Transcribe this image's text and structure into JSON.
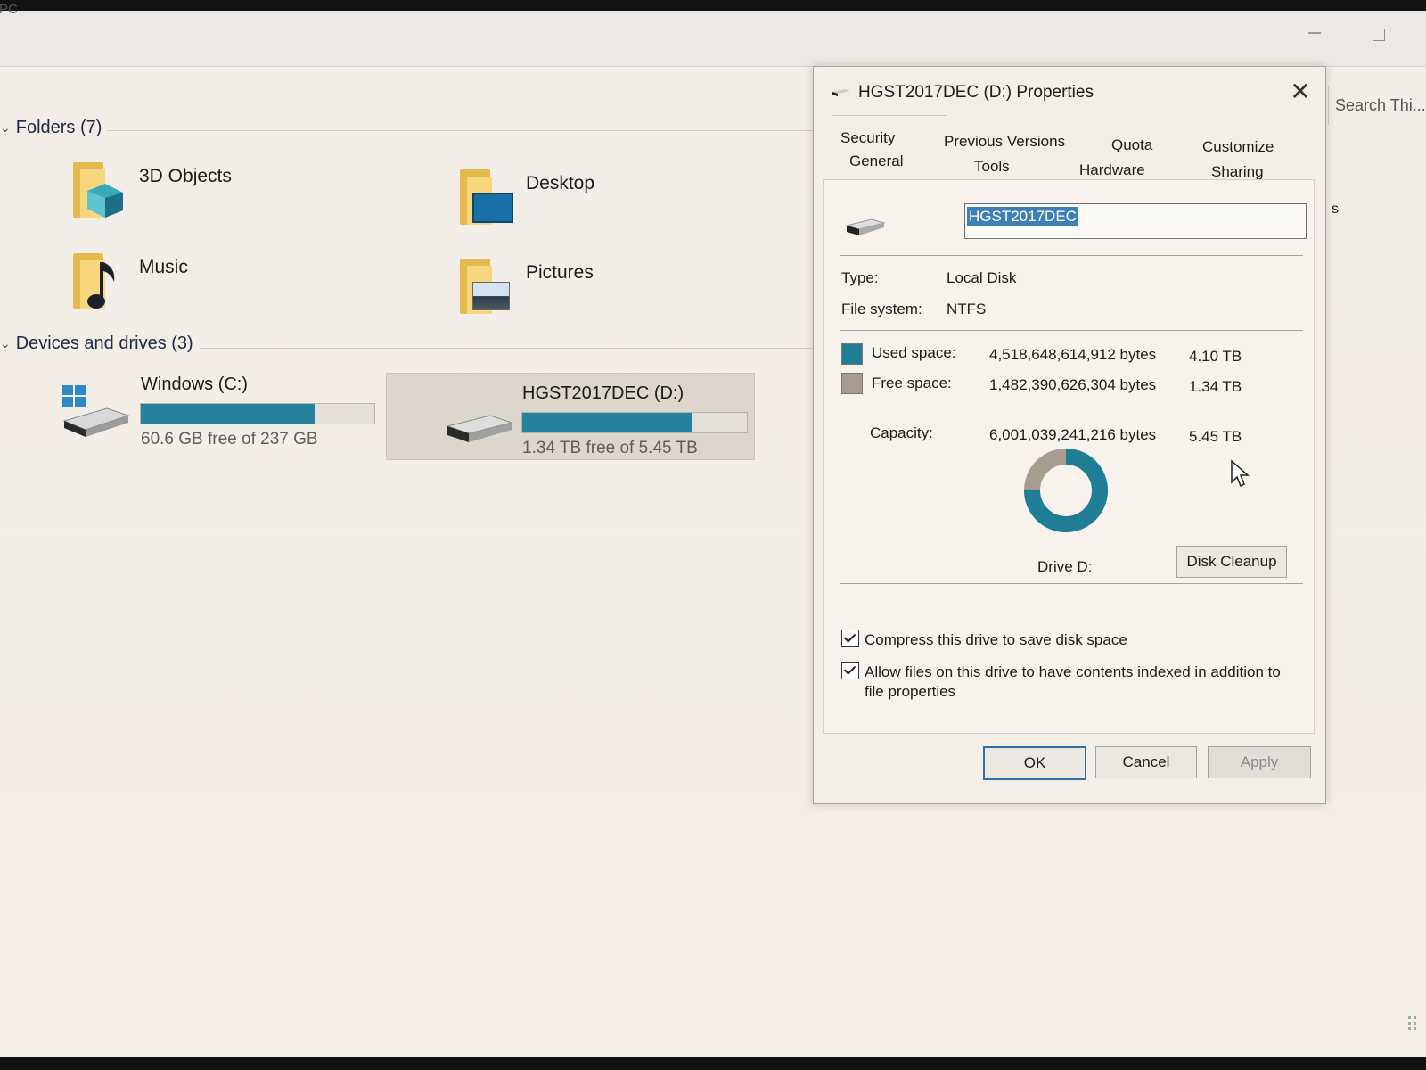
{
  "explorer": {
    "window_title": "is PC",
    "search_placeholder": "Search Thi...",
    "partial_text": "s",
    "folders_header": "Folders (7)",
    "folders": [
      {
        "label": "3D Objects",
        "icon": "3d-objects-folder-icon"
      },
      {
        "label": "Desktop",
        "icon": "desktop-folder-icon"
      },
      {
        "label": "Music",
        "icon": "music-folder-icon"
      },
      {
        "label": "Pictures",
        "icon": "pictures-folder-icon"
      }
    ],
    "devices_header": "Devices and drives (3)",
    "drives": [
      {
        "name": "Windows (C:)",
        "free_text": "60.6 GB free of 237 GB",
        "used_fraction": 0.744,
        "icon": "windows-drive-icon"
      },
      {
        "name": "HGST2017DEC (D:)",
        "free_text": "1.34 TB free of 5.45 TB",
        "used_fraction": 0.754,
        "icon": "hdd-icon",
        "selected": true
      }
    ]
  },
  "dialog": {
    "title": "HGST2017DEC (D:) Properties",
    "tabs_row1": [
      "Security",
      "Previous Versions",
      "Quota",
      "Customize"
    ],
    "tabs_row2": [
      "General",
      "Tools",
      "Hardware",
      "Sharing"
    ],
    "active_tab": "General",
    "drive_name_value": "HGST2017DEC",
    "type_label": "Type:",
    "type_value": "Local Disk",
    "fs_label": "File system:",
    "fs_value": "NTFS",
    "used_label": "Used space:",
    "used_bytes": "4,518,648,614,912 bytes",
    "used_size": "4.10 TB",
    "free_label": "Free space:",
    "free_bytes": "1,482,390,626,304 bytes",
    "free_size": "1.34 TB",
    "capacity_label": "Capacity:",
    "capacity_bytes": "6,001,039,241,216 bytes",
    "capacity_size": "5.45 TB",
    "drive_label": "Drive D:",
    "cleanup_button": "Disk Cleanup",
    "compress_label": "Compress this drive to save disk space",
    "compress_checked": true,
    "index_label_line1": "Allow files on this drive to have contents indexed in addition to",
    "index_label_line2": "file properties",
    "index_checked": true,
    "ok_button": "OK",
    "cancel_button": "Cancel",
    "apply_button": "Apply",
    "used_fraction": 0.753,
    "colors": {
      "used": "#1f7d96",
      "free": "#a79c90",
      "accent": "#3e7fb6"
    }
  }
}
